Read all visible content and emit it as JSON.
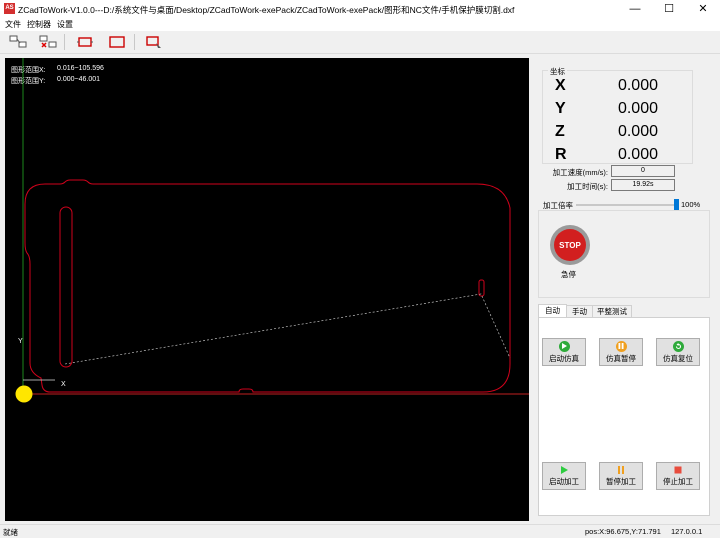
{
  "window": {
    "title": "ZCadToWork-V1.0.0---D:/系统文件与桌面/Desktop/ZCadToWork-exePack/ZCadToWork-exePack/图形和NC文件/手机保护膜切割.dxf",
    "icon_text": "AS",
    "minimize_glyph": "—",
    "maximize_glyph": "☐",
    "close_glyph": "✕"
  },
  "menu": [
    "文件",
    "控制器",
    "设置"
  ],
  "toolbar": {
    "icons": [
      "connect-computers-icon",
      "disconnect-computers-icon",
      "fit-red-frame-icon",
      "frame-icon",
      "select-frame-icon"
    ]
  },
  "canvas": {
    "range_x_label": "图形范围X:",
    "range_x_value": "0.016~105.596",
    "range_y_label": "图形范围Y:",
    "range_y_value": "0.000~46.001",
    "axis_y_label": "Y",
    "axis_x_label": "X",
    "colors": {
      "background": "#000000",
      "shape": "#d0021b",
      "axis_x": "#ff2a2a",
      "axis_y": "#22aa22",
      "path": "#dddddd",
      "origin": "#ffe600"
    }
  },
  "coords": {
    "title": "坐标",
    "axes": [
      {
        "axis": "X",
        "value": "0.000"
      },
      {
        "axis": "Y",
        "value": "0.000"
      },
      {
        "axis": "Z",
        "value": "0.000"
      },
      {
        "axis": "R",
        "value": "0.000"
      }
    ]
  },
  "speed": {
    "label": "加工速度(mm/s):",
    "value": "0"
  },
  "time": {
    "label": "加工时间(s):",
    "value": "19.92s"
  },
  "rate": {
    "label": "加工倍率",
    "value": "100%",
    "fraction": 1.0
  },
  "estop": {
    "icon_text": "STOP",
    "label": "急停"
  },
  "tabs": [
    "自动",
    "手动",
    "平整测试"
  ],
  "buttons": {
    "start_sim": "启动仿真",
    "pause_sim": "仿真暂停",
    "reset_sim": "仿真复位",
    "start_work": "启动加工",
    "pause_work": "暂停加工",
    "stop_work": "停止加工"
  },
  "status": {
    "left": "就绪",
    "pos": "pos:X:96.675,Y:71.791",
    "version": "127.0.0.1"
  }
}
